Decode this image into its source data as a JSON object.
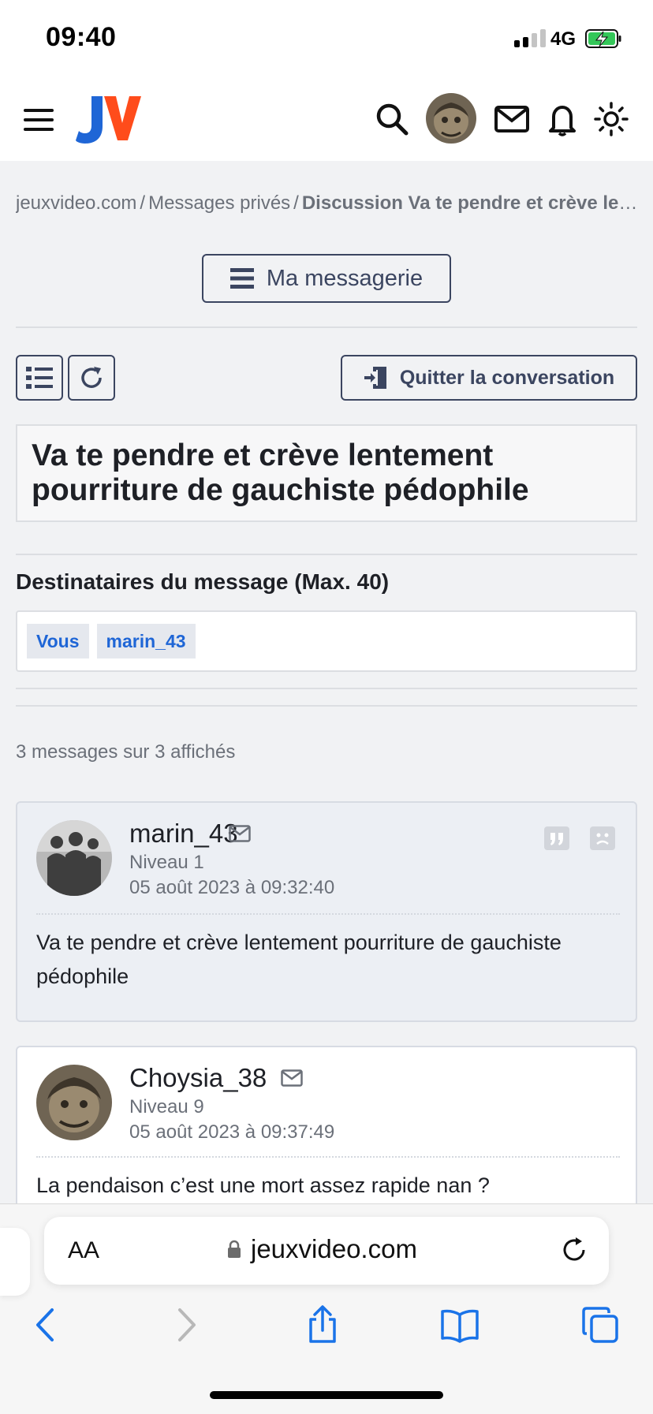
{
  "status_bar": {
    "time": "09:40",
    "network": "4G",
    "battery_color": "#34c759"
  },
  "header": {
    "logo_text": "JV",
    "icons": [
      "menu-icon",
      "search-icon",
      "avatar",
      "mail-icon",
      "bell-icon",
      "sun-icon"
    ]
  },
  "breadcrumb": {
    "items": [
      "jeuxvideo.com",
      "Messages privés"
    ],
    "current": "Discussion Va te pendre et crève lentement pourriture de gauchiste pédophile",
    "separator": "/"
  },
  "messagerie_button": "Ma messagerie",
  "quit_button": "Quitter la conversation",
  "conversation_title": "Va te pendre et crève lentement pourriture de gauchiste pédophile",
  "recipients": {
    "label": "Destinataires du message (Max. 40)",
    "list": [
      "Vous",
      "marin_43"
    ]
  },
  "message_count": "3 messages sur 3 affichés",
  "messages": [
    {
      "author": "marin_43",
      "level": "Niveau 1",
      "date": "05 août 2023 à 09:32:40",
      "body": "Va te pendre et crève lentement pourriture de gauchiste pédophile"
    },
    {
      "author": "Choysia_38",
      "level": "Niveau 9",
      "date": "05 août 2023 à 09:37:49",
      "body": "La pendaison c’est une mort assez rapide nan ?"
    }
  ],
  "safari": {
    "text_size_label": "AA",
    "url": "jeuxvideo.com"
  },
  "colors": {
    "accent_blue": "#1f66d6",
    "accent_orange": "#ff4c1b",
    "button_border": "#3b4560"
  }
}
